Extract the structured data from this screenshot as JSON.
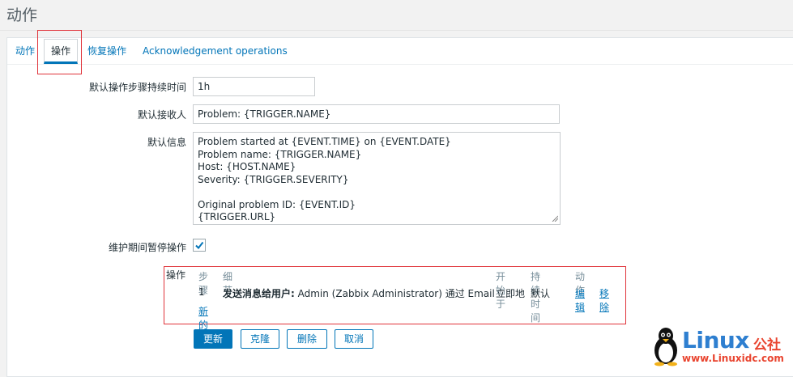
{
  "page": {
    "title": "动作"
  },
  "tabs": [
    {
      "label": "动作"
    },
    {
      "label": "操作"
    },
    {
      "label": "恢复操作"
    },
    {
      "label": "Acknowledgement operations"
    }
  ],
  "form": {
    "step_duration": {
      "label": "默认操作步骤持续时间",
      "value": "1h"
    },
    "subject": {
      "label": "默认接收人",
      "value": "Problem: {TRIGGER.NAME}"
    },
    "message": {
      "label": "默认信息",
      "value": "Problem started at {EVENT.TIME} on {EVENT.DATE}\nProblem name: {TRIGGER.NAME}\nHost: {HOST.NAME}\nSeverity: {TRIGGER.SEVERITY}\n\nOriginal problem ID: {EVENT.ID}\n{TRIGGER.URL}"
    },
    "pause": {
      "label": "维护期间暂停操作",
      "checked": true
    }
  },
  "operations": {
    "label": "操作",
    "headers": [
      "步骤",
      "细节",
      "开始于",
      "持续时间",
      "动作"
    ],
    "rows": [
      {
        "step": "1",
        "detail_bold": "发送消息给用户:",
        "detail_rest": " Admin (Zabbix Administrator) 通过 Email",
        "start": "立即地",
        "duration": "默认",
        "edit": "编辑",
        "remove": "移除"
      }
    ],
    "new_link": "新的"
  },
  "buttons": {
    "update": "更新",
    "clone": "克隆",
    "delete": "删除",
    "cancel": "取消"
  },
  "watermark": {
    "brand": "Linux",
    "brand_cn": "公社",
    "url": "www.Linuxidc.com"
  },
  "colors": {
    "accent": "#0275b8",
    "highlight": "#e0343b"
  }
}
